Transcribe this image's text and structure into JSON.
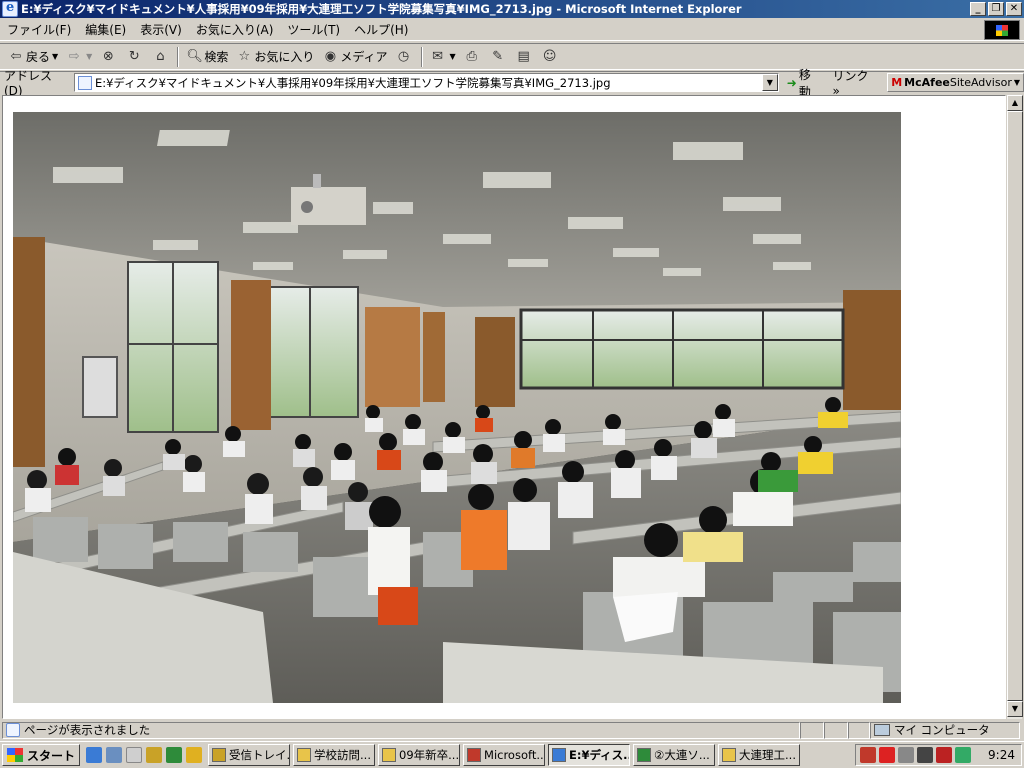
{
  "window": {
    "title": "E:¥ディスク¥マイドキュメント¥人事採用¥09年採用¥大連理工ソフト学院募集写真¥IMG_2713.jpg - Microsoft Internet Explorer",
    "buttons": {
      "minimize": "_",
      "restore": "❐",
      "close": "✕"
    }
  },
  "menubar": {
    "items": [
      "ファイル(F)",
      "編集(E)",
      "表示(V)",
      "お気に入り(A)",
      "ツール(T)",
      "ヘルプ(H)"
    ]
  },
  "toolbar": {
    "back": "戻る",
    "search": "検索",
    "favorites": "お気に入り",
    "media": "メディア"
  },
  "addressbar": {
    "label": "アドレス(D)",
    "value": "E:¥ディスク¥マイドキュメント¥人事採用¥09年採用¥大連理工ソフト学院募集写真¥IMG_2713.jpg",
    "go": "移動",
    "links": "リンク »",
    "mcafee_brand": "McAfee",
    "mcafee_product": "SiteAdvisor"
  },
  "content": {
    "image_alt": "IMG_2713.jpg"
  },
  "statusbar": {
    "message": "ページが表示されました",
    "zone": "マイ コンピュータ"
  },
  "taskbar": {
    "start": "スタート",
    "tasks": [
      {
        "label": "受信トレイ...",
        "color": "#c9a227",
        "active": false
      },
      {
        "label": "学校訪問...",
        "color": "#e8c44a",
        "active": false
      },
      {
        "label": "09年新卒...",
        "color": "#e8c44a",
        "active": false
      },
      {
        "label": "Microsoft...",
        "color": "#c0392b",
        "active": false
      },
      {
        "label": "E:¥ディス...",
        "color": "#3a7bd5",
        "active": true
      },
      {
        "label": "②大連ソ...",
        "color": "#2e8b3a",
        "active": false
      },
      {
        "label": "大連理工...",
        "color": "#e8c44a",
        "active": false
      }
    ],
    "clock": "9:24"
  },
  "colors": {
    "title_start": "#0a246a",
    "title_end": "#3a6ea5",
    "chrome": "#d4d0c8"
  }
}
